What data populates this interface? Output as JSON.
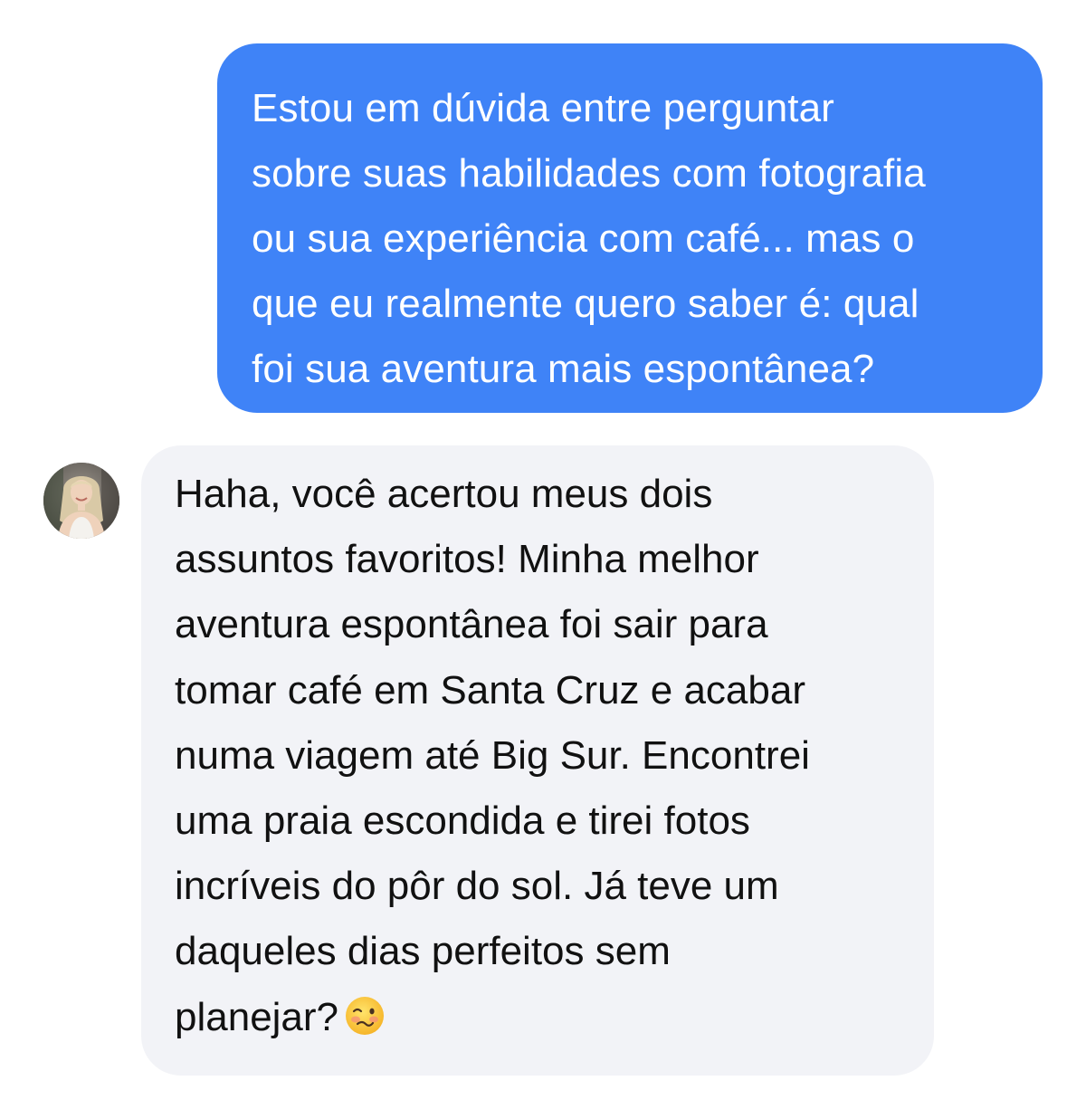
{
  "conversation": {
    "outgoing": {
      "lines": [
        "Estou em dúvida entre perguntar",
        "sobre suas habilidades com fotografia",
        "ou sua experiência com café... mas o",
        "que eu realmente quero saber é: qual",
        "foi sua aventura mais espontânea?"
      ],
      "bubble_color": "#3f83f7",
      "text_color": "#ffffff"
    },
    "incoming": {
      "lines": [
        "Haha, você acertou meus dois",
        "assuntos favoritos! Minha melhor",
        "aventura espontânea foi sair para",
        "tomar café em Santa Cruz e acabar",
        "numa viagem até Big Sur. Encontrei",
        "uma praia escondida e tirei fotos",
        "incríveis do pôr do sol. Já teve um",
        "daqueles dias perfeitos sem",
        "planejar?"
      ],
      "emoji": "woozy-face-emoji",
      "bubble_color": "#f2f3f7",
      "text_color": "#111111",
      "avatar": "profile-photo-avatar"
    }
  }
}
